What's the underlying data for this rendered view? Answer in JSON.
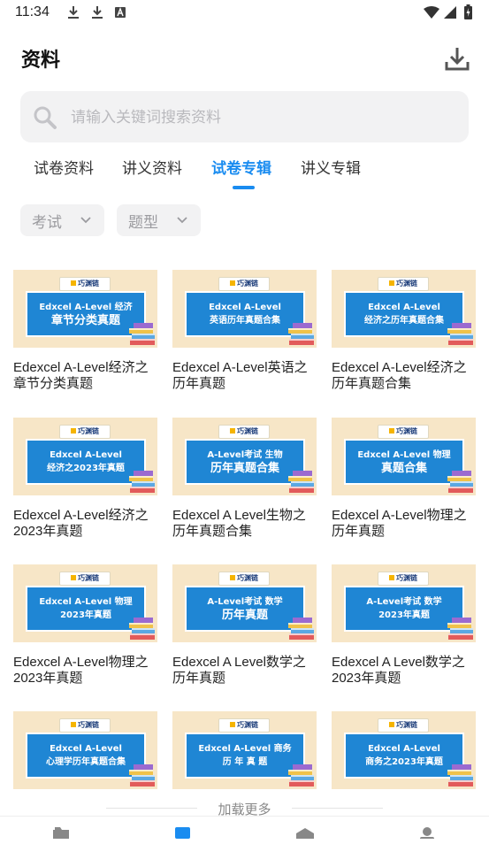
{
  "status_bar": {
    "time": "11:34",
    "left_icons": [
      "download-icon",
      "download-icon",
      "a-badge-icon"
    ],
    "right_icons": [
      "wifi-icon",
      "signal-icon",
      "battery-icon"
    ]
  },
  "header": {
    "title": "资料",
    "download_icon": "download-icon"
  },
  "search": {
    "placeholder": "请输入关键词搜索资料",
    "icon": "search-icon"
  },
  "tabs": [
    {
      "label": "试卷资料",
      "active": false
    },
    {
      "label": "讲义资料",
      "active": false
    },
    {
      "label": "试卷专辑",
      "active": true
    },
    {
      "label": "讲义专辑",
      "active": false
    }
  ],
  "filters": [
    {
      "label": "考试"
    },
    {
      "label": "题型"
    }
  ],
  "cards": [
    {
      "thumb_logo": "巧渊链",
      "thumb_l1": "Edxcel A-Level 经济",
      "thumb_l2": "章节分类真题",
      "title_l1": "Edexcel A-Level经济之",
      "title_l2": "章节分类真题"
    },
    {
      "thumb_logo": "巧渊链",
      "thumb_l1": "Edxcel A-Level",
      "thumb_l2": "英语历年真题合集",
      "title_l1": "Edexcel A-Level英语之",
      "title_l2": "历年真题"
    },
    {
      "thumb_logo": "巧渊链",
      "thumb_l1": "Edxcel A-Level",
      "thumb_l2": "经济之历年真题合集",
      "title_l1": "Edexcel A-Level经济之",
      "title_l2": "历年真题合集"
    },
    {
      "thumb_logo": "巧渊链",
      "thumb_l1": "Edxcel A-Level",
      "thumb_l2": "经济之2023年真题",
      "title_l1": "Edexcel A-Level经济之",
      "title_l2": "2023年真题"
    },
    {
      "thumb_logo": "巧渊链",
      "thumb_l1": "A-Level考试 生物",
      "thumb_l2": "历年真题合集",
      "title_l1": "Edexcel A Level生物之",
      "title_l2": "历年真题合集"
    },
    {
      "thumb_logo": "巧渊链",
      "thumb_l1": "Edxcel A-Level 物理",
      "thumb_l2": "真题合集",
      "title_l1": "Edexcel A-Level物理之",
      "title_l2": "历年真题"
    },
    {
      "thumb_logo": "巧渊链",
      "thumb_l1": "Edxcel A-Level 物理",
      "thumb_l2": "2023年真题",
      "title_l1": "Edexcel A-Level物理之",
      "title_l2": "2023年真题"
    },
    {
      "thumb_logo": "巧渊链",
      "thumb_l1": "A-Level考试 数学",
      "thumb_l2": "历年真题",
      "title_l1": "Edexcel A Level数学之",
      "title_l2": "历年真题"
    },
    {
      "thumb_logo": "巧渊链",
      "thumb_l1": "A-Level考试 数学",
      "thumb_l2": "2023年真题",
      "title_l1": "Edexcel A Level数学之",
      "title_l2": "2023年真题"
    },
    {
      "thumb_logo": "巧渊链",
      "thumb_l1": "Edxcel A-Level",
      "thumb_l2": "心理学历年真题合集",
      "title_l1": "",
      "title_l2": ""
    },
    {
      "thumb_logo": "巧渊链",
      "thumb_l1": "Edxcel A-Level 商务",
      "thumb_l2": "历 年 真 题",
      "title_l1": "",
      "title_l2": ""
    },
    {
      "thumb_logo": "巧渊链",
      "thumb_l1": "Edxcel A-Level",
      "thumb_l2": "商务之2023年真题",
      "title_l1": "",
      "title_l2": ""
    }
  ],
  "load_more": "加载更多",
  "bottom_nav": [
    {
      "icon": "home-icon",
      "active": false
    },
    {
      "icon": "library-icon",
      "active": true
    },
    {
      "icon": "message-icon",
      "active": false
    },
    {
      "icon": "profile-icon",
      "active": false
    }
  ],
  "colors": {
    "accent": "#1a8cf0",
    "thumb_bg": "#f7e6c7",
    "banner": "#1f86d4",
    "search_bg": "#f2f2f3"
  }
}
